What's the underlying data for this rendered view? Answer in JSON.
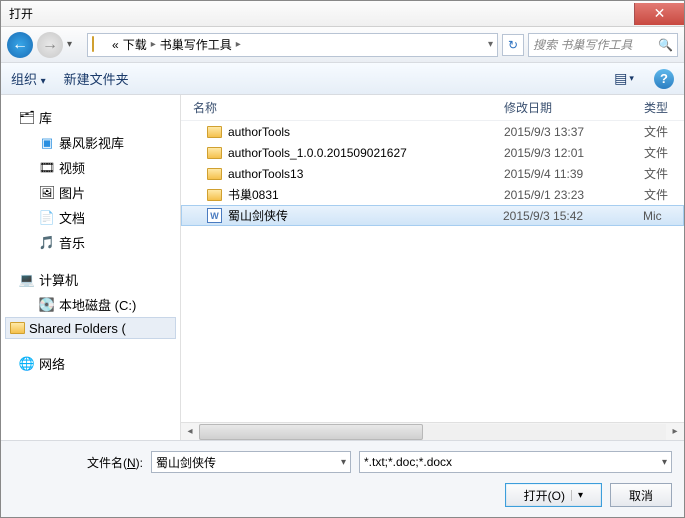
{
  "title": "打开",
  "breadcrumb": {
    "root": "«",
    "p1": "下载",
    "p2": "书巢写作工具"
  },
  "search_placeholder": "搜索 书巢写作工具",
  "toolbar": {
    "organize": "组织",
    "newfolder": "新建文件夹"
  },
  "columns": {
    "name": "名称",
    "date": "修改日期",
    "type": "类型"
  },
  "tree": {
    "library": "库",
    "video_lib": "暴风影视库",
    "videos": "视频",
    "pictures": "图片",
    "documents": "文档",
    "music": "音乐",
    "computer": "计算机",
    "cdrive": "本地磁盘 (C:)",
    "shared": "Shared Folders (",
    "network": "网络"
  },
  "files": [
    {
      "name": "authorTools",
      "date": "2015/9/3 13:37",
      "type": "文件",
      "kind": "folder"
    },
    {
      "name": "authorTools_1.0.0.201509021627",
      "date": "2015/9/3 12:01",
      "type": "文件",
      "kind": "folder"
    },
    {
      "name": "authorTools13",
      "date": "2015/9/4 11:39",
      "type": "文件",
      "kind": "folder"
    },
    {
      "name": "书巢0831",
      "date": "2015/9/1 23:23",
      "type": "文件",
      "kind": "folder"
    },
    {
      "name": "蜀山剑侠传",
      "date": "2015/9/3 15:42",
      "type": "Mic",
      "kind": "doc",
      "selected": true
    }
  ],
  "filename": {
    "label_pre": "文件名(",
    "label_key": "N",
    "label_post": "):",
    "value": "蜀山剑侠传"
  },
  "filter": "*.txt;*.doc;*.docx",
  "buttons": {
    "open": "打开(O)",
    "cancel": "取消"
  }
}
